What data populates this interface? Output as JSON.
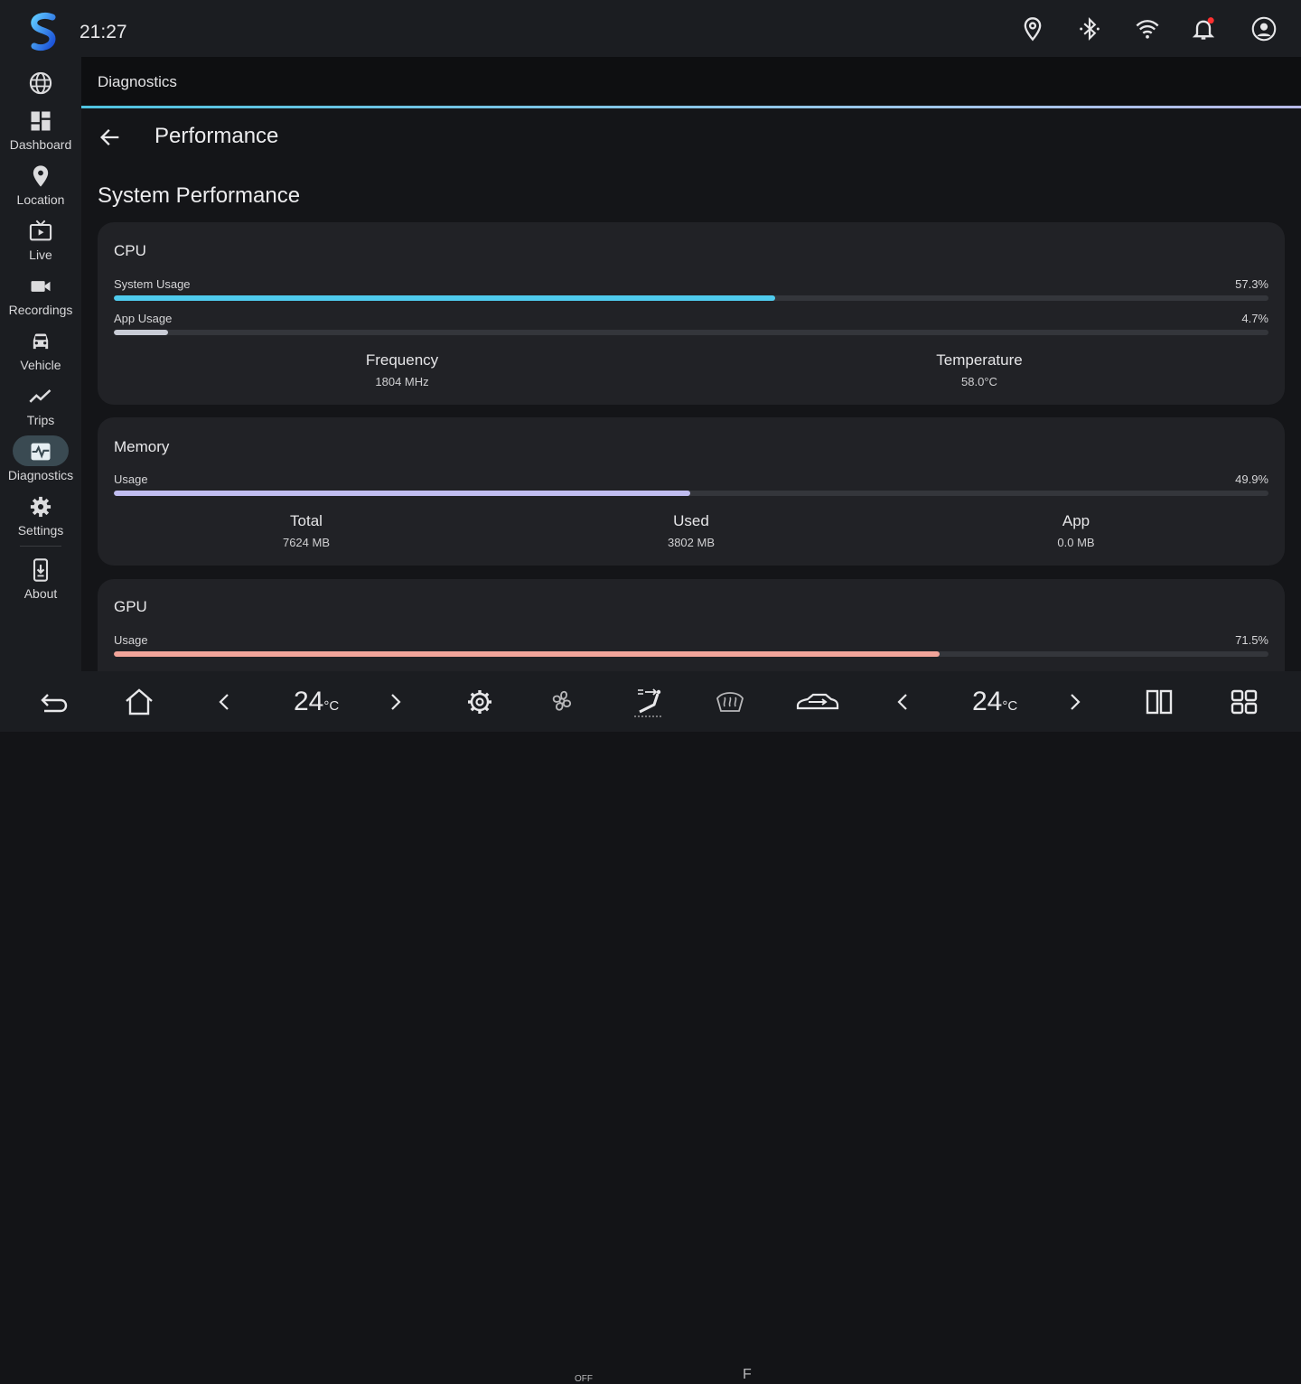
{
  "status_bar": {
    "time": "21:27"
  },
  "sidebar": {
    "items": [
      {
        "label": "",
        "icon": "globe-icon"
      },
      {
        "label": "Dashboard",
        "icon": "dashboard-icon"
      },
      {
        "label": "Location",
        "icon": "location-pin-icon"
      },
      {
        "label": "Live",
        "icon": "live-tv-icon"
      },
      {
        "label": "Recordings",
        "icon": "video-camera-icon"
      },
      {
        "label": "Vehicle",
        "icon": "car-icon"
      },
      {
        "label": "Trips",
        "icon": "trend-icon"
      },
      {
        "label": "Diagnostics",
        "icon": "pulse-icon",
        "active": true
      },
      {
        "label": "Settings",
        "icon": "gear-icon"
      },
      {
        "label": "About",
        "icon": "phone-download-icon"
      }
    ]
  },
  "header": {
    "title": "Diagnostics"
  },
  "page": {
    "title": "Performance",
    "section_title": "System Performance"
  },
  "cpu": {
    "title": "CPU",
    "system_usage": {
      "label": "System Usage",
      "value": "57.3%",
      "fraction": 0.573,
      "color": "#4fcbed"
    },
    "app_usage": {
      "label": "App Usage",
      "value": "4.7%",
      "fraction": 0.047,
      "color": "#c9ccd6"
    },
    "frequency": {
      "label": "Frequency",
      "value": "1804 MHz"
    },
    "temperature": {
      "label": "Temperature",
      "value": "58.0°C"
    }
  },
  "memory": {
    "title": "Memory",
    "usage": {
      "label": "Usage",
      "value": "49.9%",
      "fraction": 0.499,
      "color": "#c0bdf0"
    },
    "total": {
      "label": "Total",
      "value": "7624 MB"
    },
    "used": {
      "label": "Used",
      "value": "3802 MB"
    },
    "app": {
      "label": "App",
      "value": "0.0 MB"
    }
  },
  "gpu": {
    "title": "GPU",
    "usage": {
      "label": "Usage",
      "value": "71.5%",
      "fraction": 0.715,
      "color": "#f2a49a"
    }
  },
  "climate": {
    "left_temp": "24",
    "right_temp": "24",
    "unit": "°C",
    "fan_status": "OFF",
    "defrost_label": "F"
  }
}
